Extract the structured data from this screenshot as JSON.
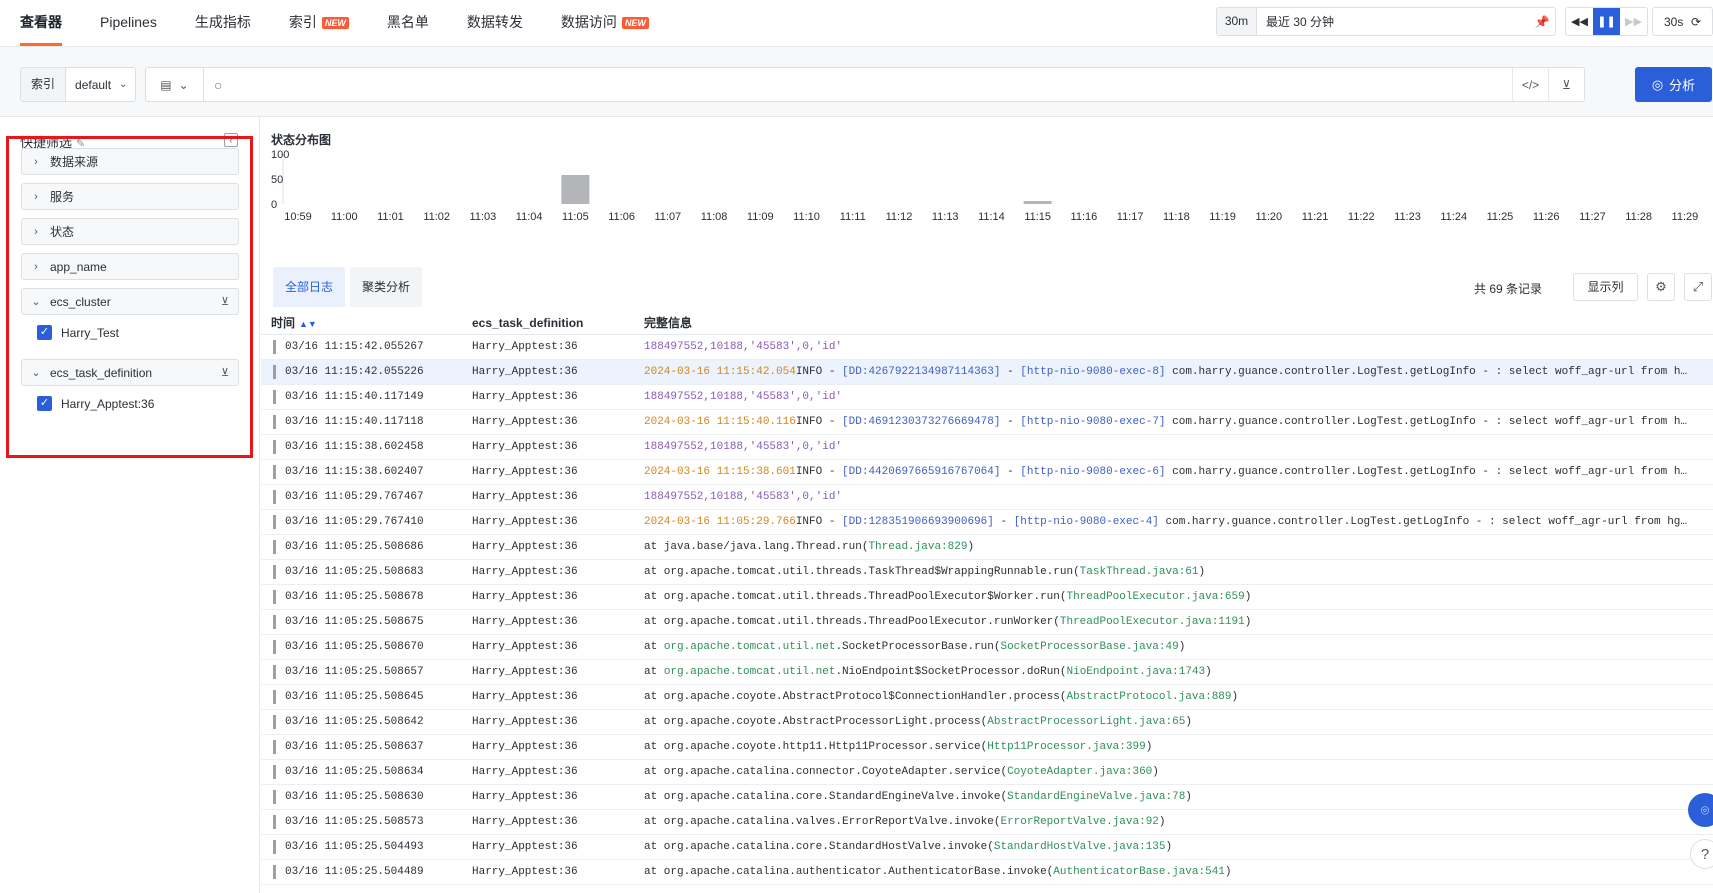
{
  "nav": {
    "tabs": [
      {
        "label": "查看器",
        "badge": ""
      },
      {
        "label": "Pipelines",
        "badge": ""
      },
      {
        "label": "生成指标",
        "badge": ""
      },
      {
        "label": "索引",
        "badge": "NEW"
      },
      {
        "label": "黑名单",
        "badge": ""
      },
      {
        "label": "数据转发",
        "badge": ""
      },
      {
        "label": "数据访问",
        "badge": "NEW"
      }
    ],
    "time_short": "30m",
    "time_text": "最近 30 分钟",
    "refresh_interval": "30s"
  },
  "query": {
    "index_label": "索引",
    "index_value": "default",
    "search_value": "",
    "analyze_label": "分析"
  },
  "sidebar": {
    "title": "快捷筛选",
    "facets": [
      {
        "label": "数据来源",
        "expanded": false
      },
      {
        "label": "服务",
        "expanded": false
      },
      {
        "label": "状态",
        "expanded": false
      },
      {
        "label": "app_name",
        "expanded": false
      },
      {
        "label": "ecs_cluster",
        "expanded": true,
        "values": [
          "Harry_Test"
        ]
      },
      {
        "label": "ecs_task_definition",
        "expanded": true,
        "values": [
          "Harry_Apptest:36"
        ]
      }
    ],
    "highlight_color": "#e5171b"
  },
  "chart_data": {
    "type": "bar",
    "title": "状态分布图",
    "categories": [
      "10:59",
      "11:00",
      "11:01",
      "11:02",
      "11:03",
      "11:04",
      "11:05",
      "11:06",
      "11:07",
      "11:08",
      "11:09",
      "11:10",
      "11:11",
      "11:12",
      "11:13",
      "11:14",
      "11:15",
      "11:16",
      "11:17",
      "11:18",
      "11:19",
      "11:20",
      "11:21",
      "11:22",
      "11:23",
      "11:24",
      "11:25",
      "11:26",
      "11:27",
      "11:28",
      "11:29"
    ],
    "values": [
      0,
      0,
      0,
      0,
      0,
      0,
      58,
      0,
      0,
      0,
      0,
      0,
      0,
      0,
      0,
      0,
      6,
      0,
      0,
      0,
      0,
      0,
      0,
      0,
      0,
      0,
      0,
      0,
      0,
      0,
      0
    ],
    "y_ticks": [
      100,
      50,
      0
    ],
    "ylim": [
      0,
      100
    ],
    "bar_color": "#b3b5b9"
  },
  "logs": {
    "tabs": [
      "全部日志",
      "聚类分析"
    ],
    "record_count": "共 69 条记录",
    "columns_button": "显示列",
    "headers": {
      "time": "时间",
      "definition": "ecs_task_definition",
      "message": "完整信息"
    },
    "rows": [
      {
        "time": "03/16 11:15:42.055267",
        "def": "Harry_Apptest:36",
        "msg": [
          [
            "pp",
            "188497552,10188,'45583',0,'id'"
          ]
        ]
      },
      {
        "time": "03/16 11:15:42.055226",
        "def": "Harry_Apptest:36",
        "selected": true,
        "msg": [
          [
            "or",
            "2024-03-16 11:15:42.054"
          ],
          [
            "",
            "INFO - "
          ],
          [
            "bl",
            "[DD:4267922134987114363]"
          ],
          [
            "",
            " - "
          ],
          [
            "bl",
            "[http-nio-9080-exec-8]"
          ],
          [
            "",
            " com.harry.guance.controller.LogTest.getLogInfo - : select woff_agr-url from h…"
          ]
        ]
      },
      {
        "time": "03/16 11:15:40.117149",
        "def": "Harry_Apptest:36",
        "msg": [
          [
            "pp",
            "188497552,10188,'45583',0,'id'"
          ]
        ]
      },
      {
        "time": "03/16 11:15:40.117118",
        "def": "Harry_Apptest:36",
        "msg": [
          [
            "or",
            "2024-03-16 11:15:40.116"
          ],
          [
            "",
            "INFO - "
          ],
          [
            "bl",
            "[DD:4691230373276669478]"
          ],
          [
            "",
            " - "
          ],
          [
            "bl",
            "[http-nio-9080-exec-7]"
          ],
          [
            "",
            " com.harry.guance.controller.LogTest.getLogInfo - : select woff_agr-url from h…"
          ]
        ]
      },
      {
        "time": "03/16 11:15:38.602458",
        "def": "Harry_Apptest:36",
        "msg": [
          [
            "pp",
            "188497552,10188,'45583',0,'id'"
          ]
        ]
      },
      {
        "time": "03/16 11:15:38.602407",
        "def": "Harry_Apptest:36",
        "msg": [
          [
            "or",
            "2024-03-16 11:15:38.601"
          ],
          [
            "",
            "INFO - "
          ],
          [
            "bl",
            "[DD:4420697665916767064]"
          ],
          [
            "",
            " - "
          ],
          [
            "bl",
            "[http-nio-9080-exec-6]"
          ],
          [
            "",
            " com.harry.guance.controller.LogTest.getLogInfo - : select woff_agr-url from h…"
          ]
        ]
      },
      {
        "time": "03/16 11:05:29.767467",
        "def": "Harry_Apptest:36",
        "msg": [
          [
            "pp",
            "188497552,10188,'45583',0,'id'"
          ]
        ]
      },
      {
        "time": "03/16 11:05:29.767410",
        "def": "Harry_Apptest:36",
        "msg": [
          [
            "or",
            "2024-03-16 11:05:29.766"
          ],
          [
            "",
            "INFO - "
          ],
          [
            "bl",
            "[DD:128351906693900696]"
          ],
          [
            "",
            " - "
          ],
          [
            "bl",
            "[http-nio-9080-exec-4]"
          ],
          [
            "",
            " com.harry.guance.controller.LogTest.getLogInfo - : select woff_agr-url from hg…"
          ]
        ]
      },
      {
        "time": "03/16 11:05:25.508686",
        "def": "Harry_Apptest:36",
        "msg": [
          [
            "",
            "at java.base/java.lang.Thread.run("
          ],
          [
            "gr",
            "Thread.java:829"
          ],
          [
            "",
            ")"
          ]
        ]
      },
      {
        "time": "03/16 11:05:25.508683",
        "def": "Harry_Apptest:36",
        "msg": [
          [
            "",
            "at org.apache.tomcat.util.threads.TaskThread$WrappingRunnable.run("
          ],
          [
            "gr",
            "TaskThread.java:61"
          ],
          [
            "",
            ")"
          ]
        ]
      },
      {
        "time": "03/16 11:05:25.508678",
        "def": "Harry_Apptest:36",
        "msg": [
          [
            "",
            "at org.apache.tomcat.util.threads.ThreadPoolExecutor$Worker.run("
          ],
          [
            "gr",
            "ThreadPoolExecutor.java:659"
          ],
          [
            "",
            ")"
          ]
        ]
      },
      {
        "time": "03/16 11:05:25.508675",
        "def": "Harry_Apptest:36",
        "msg": [
          [
            "",
            "at org.apache.tomcat.util.threads.ThreadPoolExecutor.runWorker("
          ],
          [
            "gr",
            "ThreadPoolExecutor.java:1191"
          ],
          [
            "",
            ")"
          ]
        ]
      },
      {
        "time": "03/16 11:05:25.508670",
        "def": "Harry_Apptest:36",
        "msg": [
          [
            "",
            "at "
          ],
          [
            "gr",
            "org.apache.tomcat.util.net"
          ],
          [
            "",
            ".SocketProcessorBase.run("
          ],
          [
            "gr",
            "SocketProcessorBase.java:49"
          ],
          [
            "",
            ")"
          ]
        ]
      },
      {
        "time": "03/16 11:05:25.508657",
        "def": "Harry_Apptest:36",
        "msg": [
          [
            "",
            "at "
          ],
          [
            "gr",
            "org.apache.tomcat.util.net"
          ],
          [
            "",
            ".NioEndpoint$SocketProcessor.doRun("
          ],
          [
            "gr",
            "NioEndpoint.java:1743"
          ],
          [
            "",
            ")"
          ]
        ]
      },
      {
        "time": "03/16 11:05:25.508645",
        "def": "Harry_Apptest:36",
        "msg": [
          [
            "",
            "at org.apache.coyote.AbstractProtocol$ConnectionHandler.process("
          ],
          [
            "gr",
            "AbstractProtocol.java:889"
          ],
          [
            "",
            ")"
          ]
        ]
      },
      {
        "time": "03/16 11:05:25.508642",
        "def": "Harry_Apptest:36",
        "msg": [
          [
            "",
            "at org.apache.coyote.AbstractProcessorLight.process("
          ],
          [
            "gr",
            "AbstractProcessorLight.java:65"
          ],
          [
            "",
            ")"
          ]
        ]
      },
      {
        "time": "03/16 11:05:25.508637",
        "def": "Harry_Apptest:36",
        "msg": [
          [
            "",
            "at org.apache.coyote.http11.Http11Processor.service("
          ],
          [
            "gr",
            "Http11Processor.java:399"
          ],
          [
            "",
            ")"
          ]
        ]
      },
      {
        "time": "03/16 11:05:25.508634",
        "def": "Harry_Apptest:36",
        "msg": [
          [
            "",
            "at org.apache.catalina.connector.CoyoteAdapter.service("
          ],
          [
            "gr",
            "CoyoteAdapter.java:360"
          ],
          [
            "",
            ")"
          ]
        ]
      },
      {
        "time": "03/16 11:05:25.508630",
        "def": "Harry_Apptest:36",
        "msg": [
          [
            "",
            "at org.apache.catalina.core.StandardEngineValve.invoke("
          ],
          [
            "gr",
            "StandardEngineValve.java:78"
          ],
          [
            "",
            ")"
          ]
        ]
      },
      {
        "time": "03/16 11:05:25.508573",
        "def": "Harry_Apptest:36",
        "msg": [
          [
            "",
            "at org.apache.catalina.valves.ErrorReportValve.invoke("
          ],
          [
            "gr",
            "ErrorReportValve.java:92"
          ],
          [
            "",
            ")"
          ]
        ]
      },
      {
        "time": "03/16 11:05:25.504493",
        "def": "Harry_Apptest:36",
        "msg": [
          [
            "",
            "at org.apache.catalina.core.StandardHostValve.invoke("
          ],
          [
            "gr",
            "StandardHostValve.java:135"
          ],
          [
            "",
            ")"
          ]
        ]
      },
      {
        "time": "03/16 11:05:25.504489",
        "def": "Harry_Apptest:36",
        "msg": [
          [
            "",
            "at org.apache.catalina.authenticator.AuthenticatorBase.invoke("
          ],
          [
            "gr",
            "AuthenticatorBase.java:541"
          ],
          [
            "",
            ")"
          ]
        ]
      }
    ]
  },
  "colors": {
    "accent": "#2b5fd9",
    "active_tab": "#ff6a2a",
    "badge": "#ff5a36"
  }
}
